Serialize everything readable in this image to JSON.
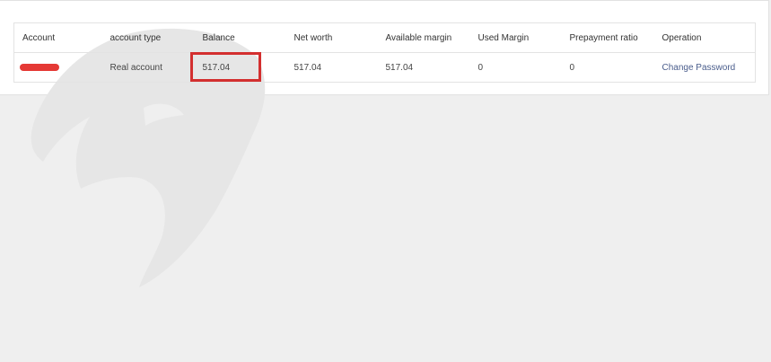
{
  "colors": {
    "page_background": "#efefef",
    "panel_background": "#ffffff",
    "link": "#4a5d8c",
    "highlight": "#d32f2f",
    "redaction": "#e53935",
    "watermark": "#e6e6e6"
  },
  "table": {
    "headers": {
      "account": "Account",
      "account_type": "account type",
      "balance": "Balance",
      "net_worth": "Net worth",
      "available_margin": "Available margin",
      "used_margin": "Used Margin",
      "prepayment_ratio": "Prepayment ratio",
      "operation": "Operation"
    },
    "rows": [
      {
        "account": "",
        "account_type": "Real account",
        "balance": "517.04",
        "net_worth": "517.04",
        "available_margin": "517.04",
        "used_margin": "0",
        "prepayment_ratio": "0",
        "operation": "Change Password"
      }
    ]
  },
  "icons": {
    "watermark": "eagle-head-logo",
    "redaction": "red-redaction-mark",
    "highlight": "red-highlight-box"
  }
}
